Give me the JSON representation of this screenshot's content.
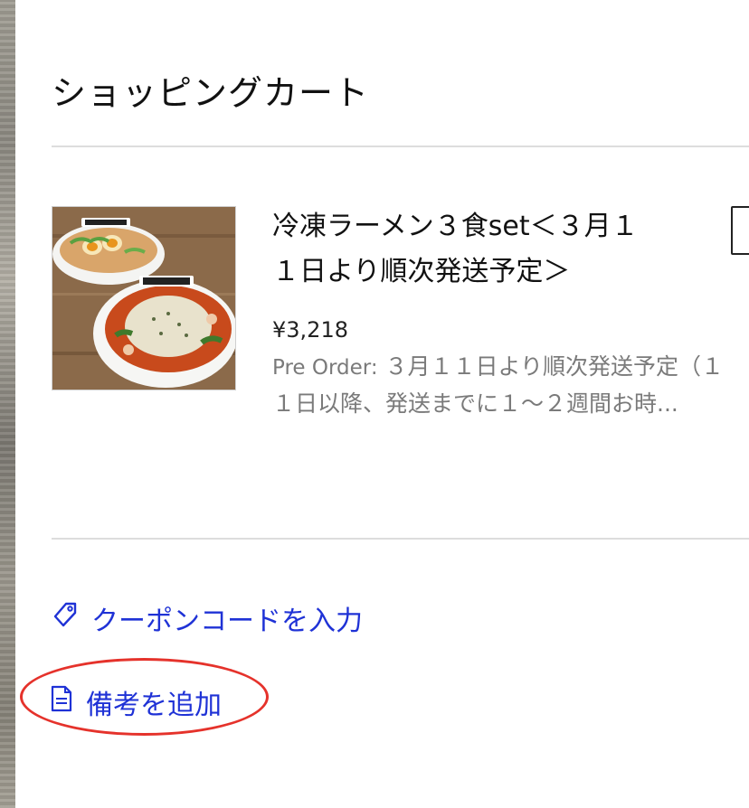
{
  "cart": {
    "title": "ショッピングカート"
  },
  "item": {
    "name": "冷凍ラーメン３食set＜３月１１日より順次発送予定＞",
    "price": "¥3,218",
    "preorder_label": "Pre Order:",
    "preorder_text": " ３月１１日より順次発送予定（１１日以降、発送までに１〜２週間お時...",
    "image_icon": "ramen-bowls-photo"
  },
  "actions": {
    "coupon_label": "クーポンコードを入力",
    "coupon_icon": "tag-icon",
    "note_label": "備考を追加",
    "note_icon": "note-icon"
  },
  "colors": {
    "link": "#1f32d6",
    "highlight": "#e5322b",
    "muted_text": "#7a7a7a"
  }
}
